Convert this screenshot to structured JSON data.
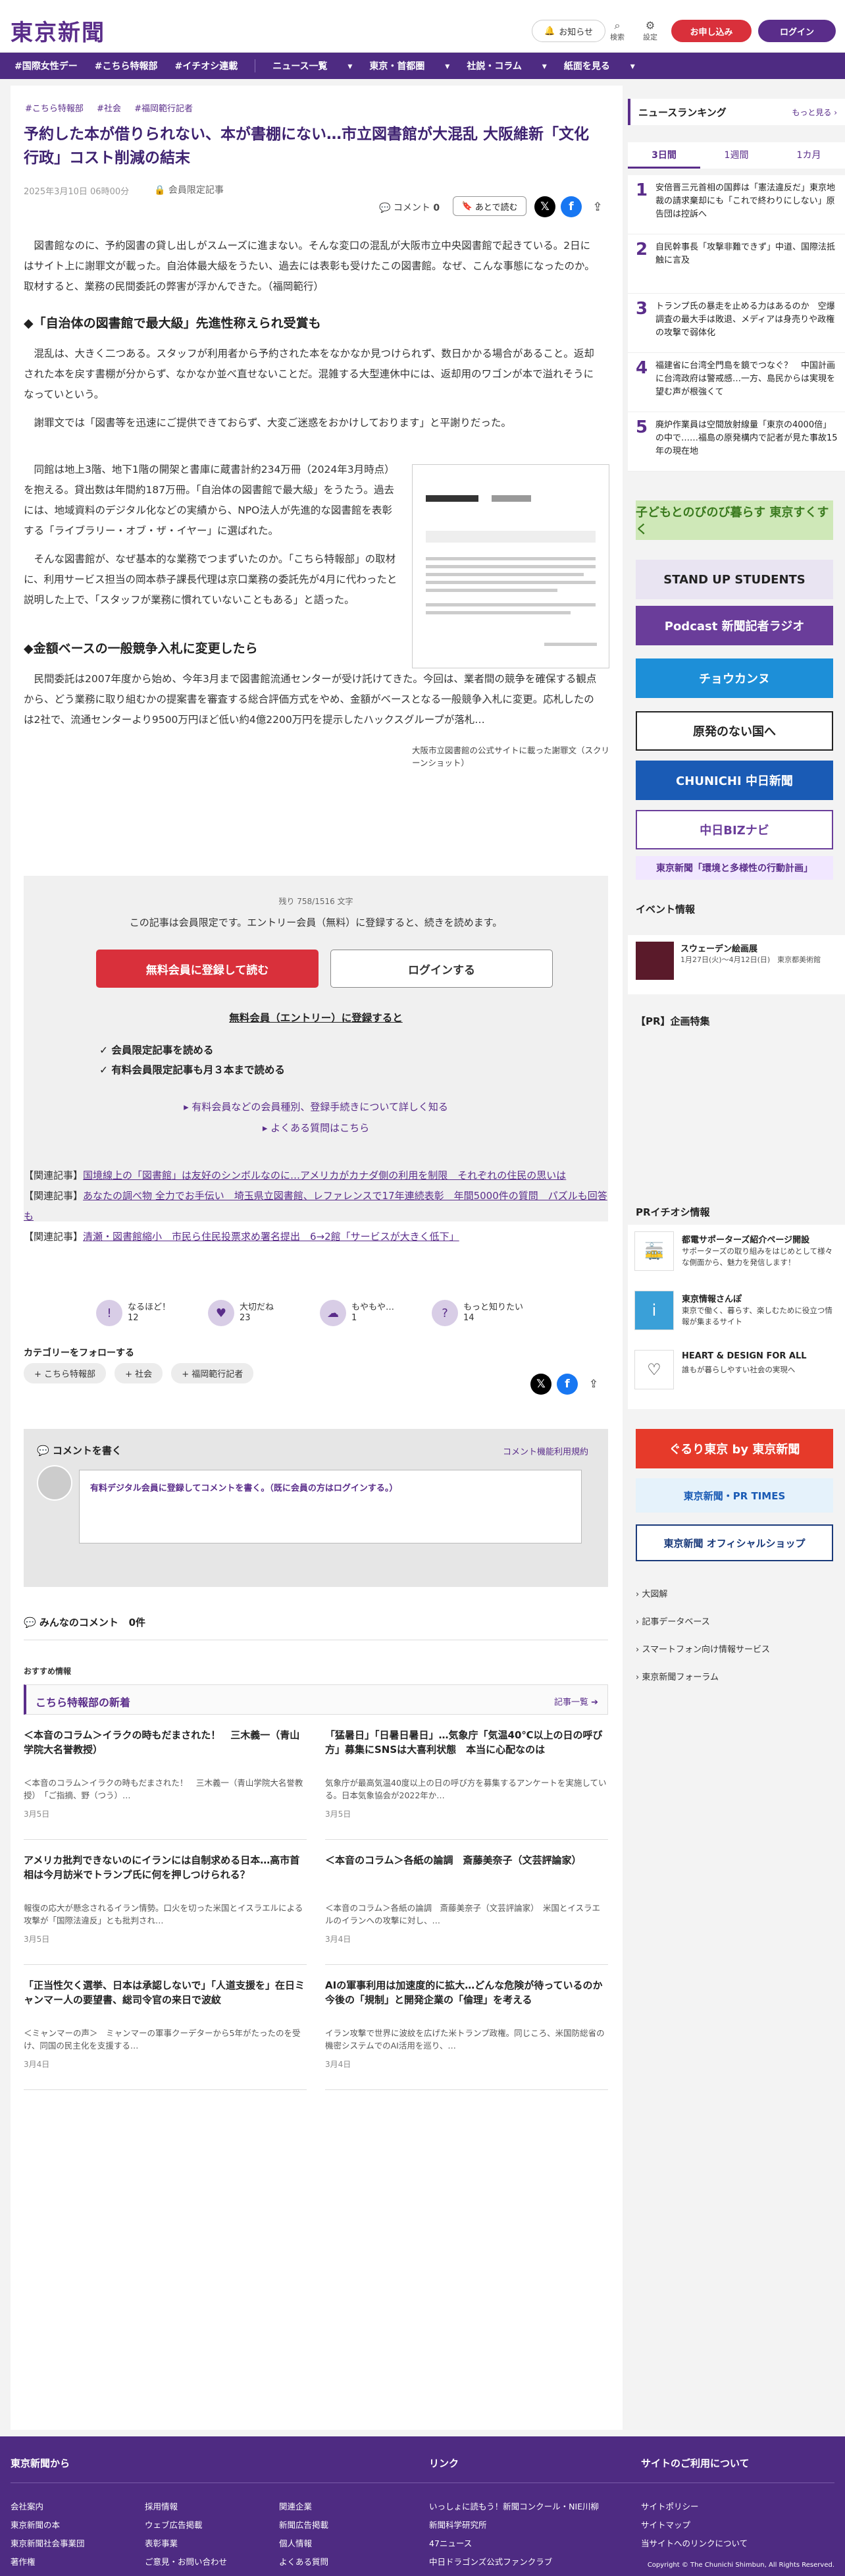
{
  "header": {
    "logo": "東京新聞",
    "notify": "お知らせ",
    "search": "検索",
    "settings": "設定",
    "register": "お申し込み",
    "login": "ログイン"
  },
  "nav": [
    "#国際女性デー",
    "#こちら特報部",
    "#イチオシ連載",
    "ニュース一覧",
    "東京・首都圏",
    "社説・コラム",
    "紙面を見る"
  ],
  "article": {
    "tags": [
      "#こちら特報部",
      "#社会",
      "#福岡範行記者"
    ],
    "title": "予約した本が借りられない、本が書棚にない…市立図書館が大混乱 大阪維新「文化行政」コスト削減の結末",
    "date": "2025年3月10日 06時00分",
    "members_only": "会員限定記事",
    "comment_label": "コメント",
    "comment_count": "0",
    "read_later": "あとで読む",
    "p1": "図書館なのに、予約図書の貸し出しがスムーズに進まない。そんな変口の混乱が大阪市立中央図書館で起きている。2日にはサイト上に謝罪文が載った。自治体最大級をうたい、過去には表彰も受けたこの図書館。なぜ、こんな事態になったのか。取材すると、業務の民間委託の弊害が浮かんできた。（福岡範行）",
    "h1": "◆「自治体の図書館で最大級」先進性称えられ受賞も",
    "p2": "混乱は、大きく二つある。スタッフが利用者から予約された本をなかなか見つけられず、数日かかる場合があること。返却された本を戻す書棚が分からず、なかなか並べ直せないことだ。混雑する大型連休中には、返却用のワゴンが本で溢れそうになっていという。",
    "p3": "謝罪文では「図書等を迅速にご提供できておらず、大変ご迷惑をおかけしております」と平謝りだった。",
    "p4": "同館は地上3階、地下1階の開架と書庫に蔵書計約234万冊（2024年3月時点）を抱える。貸出数は年間約187万冊。「自治体の図書館で最大級」をうたう。過去には、地域資料のデジタル化などの実績から、NPO法人が先進的な図書館を表彰する「ライブラリー・オブ・ザ・イヤー」に選ばれた。",
    "p5": "そんな図書館が、なぜ基本的な業務でつまずいたのか。「こちら特報部」の取材に、利用サービス担当の岡本恭子課長代理は京口業務の委託先が4月に代わったと説明した上で、「スタッフが業務に慣れていないこともある」と語った。",
    "h2": "◆金額ベースの一般競争入札に変更したら",
    "p6": "民間委託は2007年度から始め、今年3月まで図書館流通センターが受け託けてきた。今回は、業者間の競争を確保する観点から、どう業務に取り組むかの提案書を審査する総合評価方式をやめ、金額がベースとなる一般競争入札に変更。応札したのは2社で、流通センターより9500万円ほど低い約4億2200万円を提示したハックスグループが落札…",
    "fig_caption": "大阪市立図書館の公式サイトに載った謝罪文（スクリーンショット）"
  },
  "paywall": {
    "count": "残り 758/1516 文字",
    "msg": "この記事は会員限定です。エントリー会員（無料）に登録すると、続きを読めます。",
    "register_btn": "無料会員に登録して読む",
    "login_btn": "ログインする",
    "sub": "無料会員（エントリー）に登録すると",
    "benefits": [
      "会員限定記事を読める",
      "有料会員限定記事も月３本まで読める"
    ],
    "link1": "有料会員などの会員種別、登録手続きについて詳しく知る",
    "link2": "よくある質問はこちら"
  },
  "related": [
    {
      "label": "【関連記事】",
      "title": "国境線上の「図書館」は友好のシンボルなのに…アメリカがカナダ側の利用を制限　それぞれの住民の思いは"
    },
    {
      "label": "【関連記事】",
      "title": "あなたの調べ物 全力でお手伝い　埼玉県立図書館、レファレンスで17年連続表彰　年間5000件の質問　パズルも回答も"
    },
    {
      "label": "【関連記事】",
      "title": "清瀬・図書館縮小　市民ら住民投票求め署名提出　6→2館「サービスが大きく低下」"
    }
  ],
  "reactions": [
    {
      "label": "なるほど！",
      "count": "12"
    },
    {
      "label": "大切だね",
      "count": "23"
    },
    {
      "label": "もやもや…",
      "count": "1"
    },
    {
      "label": "もっと知りたい",
      "count": "14"
    }
  ],
  "category_follow": "カテゴリーをフォローする",
  "category_chips": [
    "+ こちら特報部",
    "+ 社会",
    "+ 福岡範行記者"
  ],
  "comments": {
    "heading": "コメントを書く",
    "rules": "コメント機能利用規約",
    "input": "有料デジタル会員に登録してコメントを書く。（既に会員の方はログインする。）",
    "all": "みんなのコメント",
    "all_count": "0件"
  },
  "recommend": "おすすめ情報",
  "tokuhou": {
    "title": "こちら特報部の新着",
    "more": "記事一覧",
    "cards": [
      {
        "title": "＜本音のコラム＞イラクの時もだまされた！　三木義一（青山学院大名誉教授）",
        "excerpt": "＜本音のコラム＞イラクの時もだまされた！　三木義一（青山学院大名誉教授）　「ご指摘、野（つう）…",
        "date": "3月5日"
      },
      {
        "title": "「猛暑日」「日暑日暑日」…気象庁「気温40℃以上の日の呼び方」募集にSNSは大喜利状態　本当に心配なのは",
        "excerpt": "気象庁が最高気温40度以上の日の呼び方を募集するアンケートを実施している。日本気象協会が2022年か…",
        "date": "3月5日"
      },
      {
        "title": "アメリカ批判できないのにイランには自制求める日本…高市首相は今月訪米でトランプ氏に何を押しつけられる？",
        "excerpt": "報復の応大が懸念されるイラン情勢。口火を切った米国とイスラエルによる攻撃が「国際法違反」とも批判され…",
        "date": "3月5日"
      },
      {
        "title": "＜本音のコラム＞各紙の論調　斎藤美奈子（文芸評論家）",
        "excerpt": "＜本音のコラム＞各紙の論調　斎藤美奈子（文芸評論家）　米国とイスラエルのイランへの攻撃に対し、…",
        "date": "3月4日"
      },
      {
        "title": "「正当性欠く選挙、日本は承認しないで」「人道支援を」在日ミャンマー人の要望書、総司令官の来日で波紋",
        "excerpt": "＜ミャンマーの声＞　ミャンマーの軍事クーデターから5年がたったのを受け、同国の民主化を支援する…",
        "date": "3月4日"
      },
      {
        "title": "AIの軍事利用は加速度的に拡大…どんな危険が待っているのか　今後の「規制」と開発企業の「倫理」を考える",
        "excerpt": "イラン攻撃で世界に波紋を広げた米トランプ政権。同じころ、米国防総省の機密システムでのAI活用を巡り、…",
        "date": "3月4日"
      }
    ]
  },
  "sidebar": {
    "ranking_title": "ニュースランキング",
    "ranking_more": "もっと見る",
    "tabs": [
      "3日間",
      "1週間",
      "1カ月"
    ],
    "ranking": [
      {
        "n": "1",
        "title": "安倍晋三元首相の国葬は「憲法違反だ」東京地裁の請求棄却にも「これで終わりにしない」原告団は控訴へ"
      },
      {
        "n": "2",
        "title": "自民幹事長「攻撃非難できず」中道、国際法抵触に言及"
      },
      {
        "n": "3",
        "title": "トランプ氏の暴走を止める力はあるのか　空爆調査の最大手は敗退、メディアは身売りや政権の攻撃で弱体化"
      },
      {
        "n": "4",
        "title": "福建省に台湾全門島を鏡でつなぐ？　中国計画に台湾政府は警戒感…一方、島民からは実現を望む声が根強くて"
      },
      {
        "n": "5",
        "title": "廃炉作業員は空間放射線量「東京の4000倍」の中で……福島の原発構内で記者が見た事故15年の現在地"
      }
    ],
    "banners": [
      "子どもとのびのび暮らす 東京すくすく",
      "STAND UP STUDENTS",
      "Podcast 新聞記者ラジオ",
      "チョウカンヌ",
      "原発のない国へ",
      "CHUNICHI 中日新聞",
      "中日BIZナビ",
      "東京新聞「環境と多様性の行動計画」"
    ],
    "event_title": "イベント情報",
    "event_name": "スウェーデン絵画展",
    "event_desc": "1月27日(火)～4月12日(日)　東京都美術館",
    "pr_title": "【PR】企画特集",
    "pr_info_title": "PRイチオシ情報",
    "pr_items": [
      {
        "t": "都電サポーターズ紹介ページ開設",
        "d": "サポーターズの取り組みをはじめとして様々な側面から、魅力を発信します！"
      },
      {
        "t": "東京情報さんぽ",
        "d": "東京で働く、暮らす、楽しむために役立つ情報が集まるサイト"
      },
      {
        "t": "HEART & DESIGN FOR ALL",
        "d": "誰もが暮らしやすい社会の実現へ"
      }
    ],
    "bottom_banners": [
      "ぐるり東京 by 東京新聞",
      "東京新聞・PR TIMES",
      "東京新聞 オフィシャルショップ"
    ],
    "links": [
      "大図解",
      "記事データベース",
      "スマートフォン向け情報サービス",
      "東京新聞フォーラム"
    ]
  },
  "footer": {
    "col1": "東京新聞から",
    "col2": "リンク",
    "col3": "サイトのご利用について",
    "links1": [
      "会社案内",
      "東京新聞の本",
      "採用情報",
      "ウェブ広告掲載",
      "表彰事業",
      "ご意見・お問い合わせ",
      "関連企業",
      "新聞広告掲載",
      "個人情報",
      "東京新聞社会事業団",
      "著作権",
      "よくある質問"
    ],
    "links2": [
      "いっしょに読もう！新聞コンクール・NIE川柳",
      "新聞科学研究所",
      "47ニュース",
      "中日ドラゴンズ公式ファンクラブ"
    ],
    "links3": [
      "サイトポリシー",
      "サイトマップ",
      "当サイトへのリンクについて"
    ],
    "copyright": "Copyright © The Chunichi Shimbun, All Rights Reserved."
  }
}
